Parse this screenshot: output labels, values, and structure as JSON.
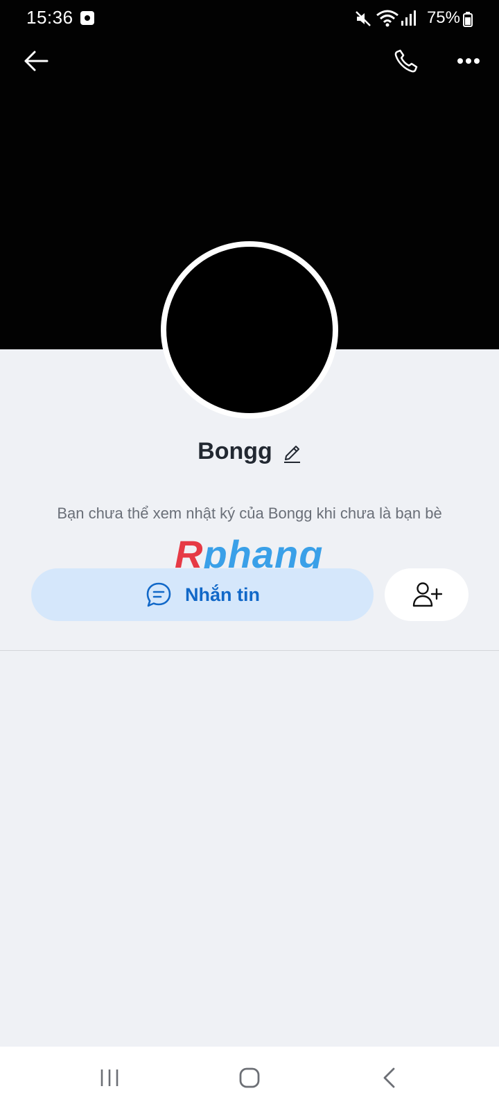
{
  "status_bar": {
    "time": "15:36",
    "battery": "75%",
    "icons": [
      "notification-icon",
      "mute-icon",
      "wifi-icon",
      "signal-icon",
      "battery-icon"
    ]
  },
  "top_nav": {
    "back_icon": "arrow-left-icon",
    "call_icon": "phone-icon",
    "more_icon": "more-horizontal-icon"
  },
  "profile": {
    "name": "Bongg",
    "edit_icon": "pencil-icon",
    "privacy_note": "Bạn chưa thể xem nhật ký của Bongg khi chưa là bạn bè"
  },
  "watermark": {
    "r": "R",
    "rest": "phang"
  },
  "actions": {
    "message_label": "Nhắn tin",
    "message_icon": "chat-bubble-icon",
    "add_friend_icon": "add-user-icon"
  },
  "system_nav": {
    "items": [
      "recent-apps-icon",
      "home-icon",
      "back-icon"
    ]
  },
  "colors": {
    "cover": "#020202",
    "background": "#eff1f5",
    "message_button_bg": "#d5e7fb",
    "accent": "#1168c8"
  }
}
